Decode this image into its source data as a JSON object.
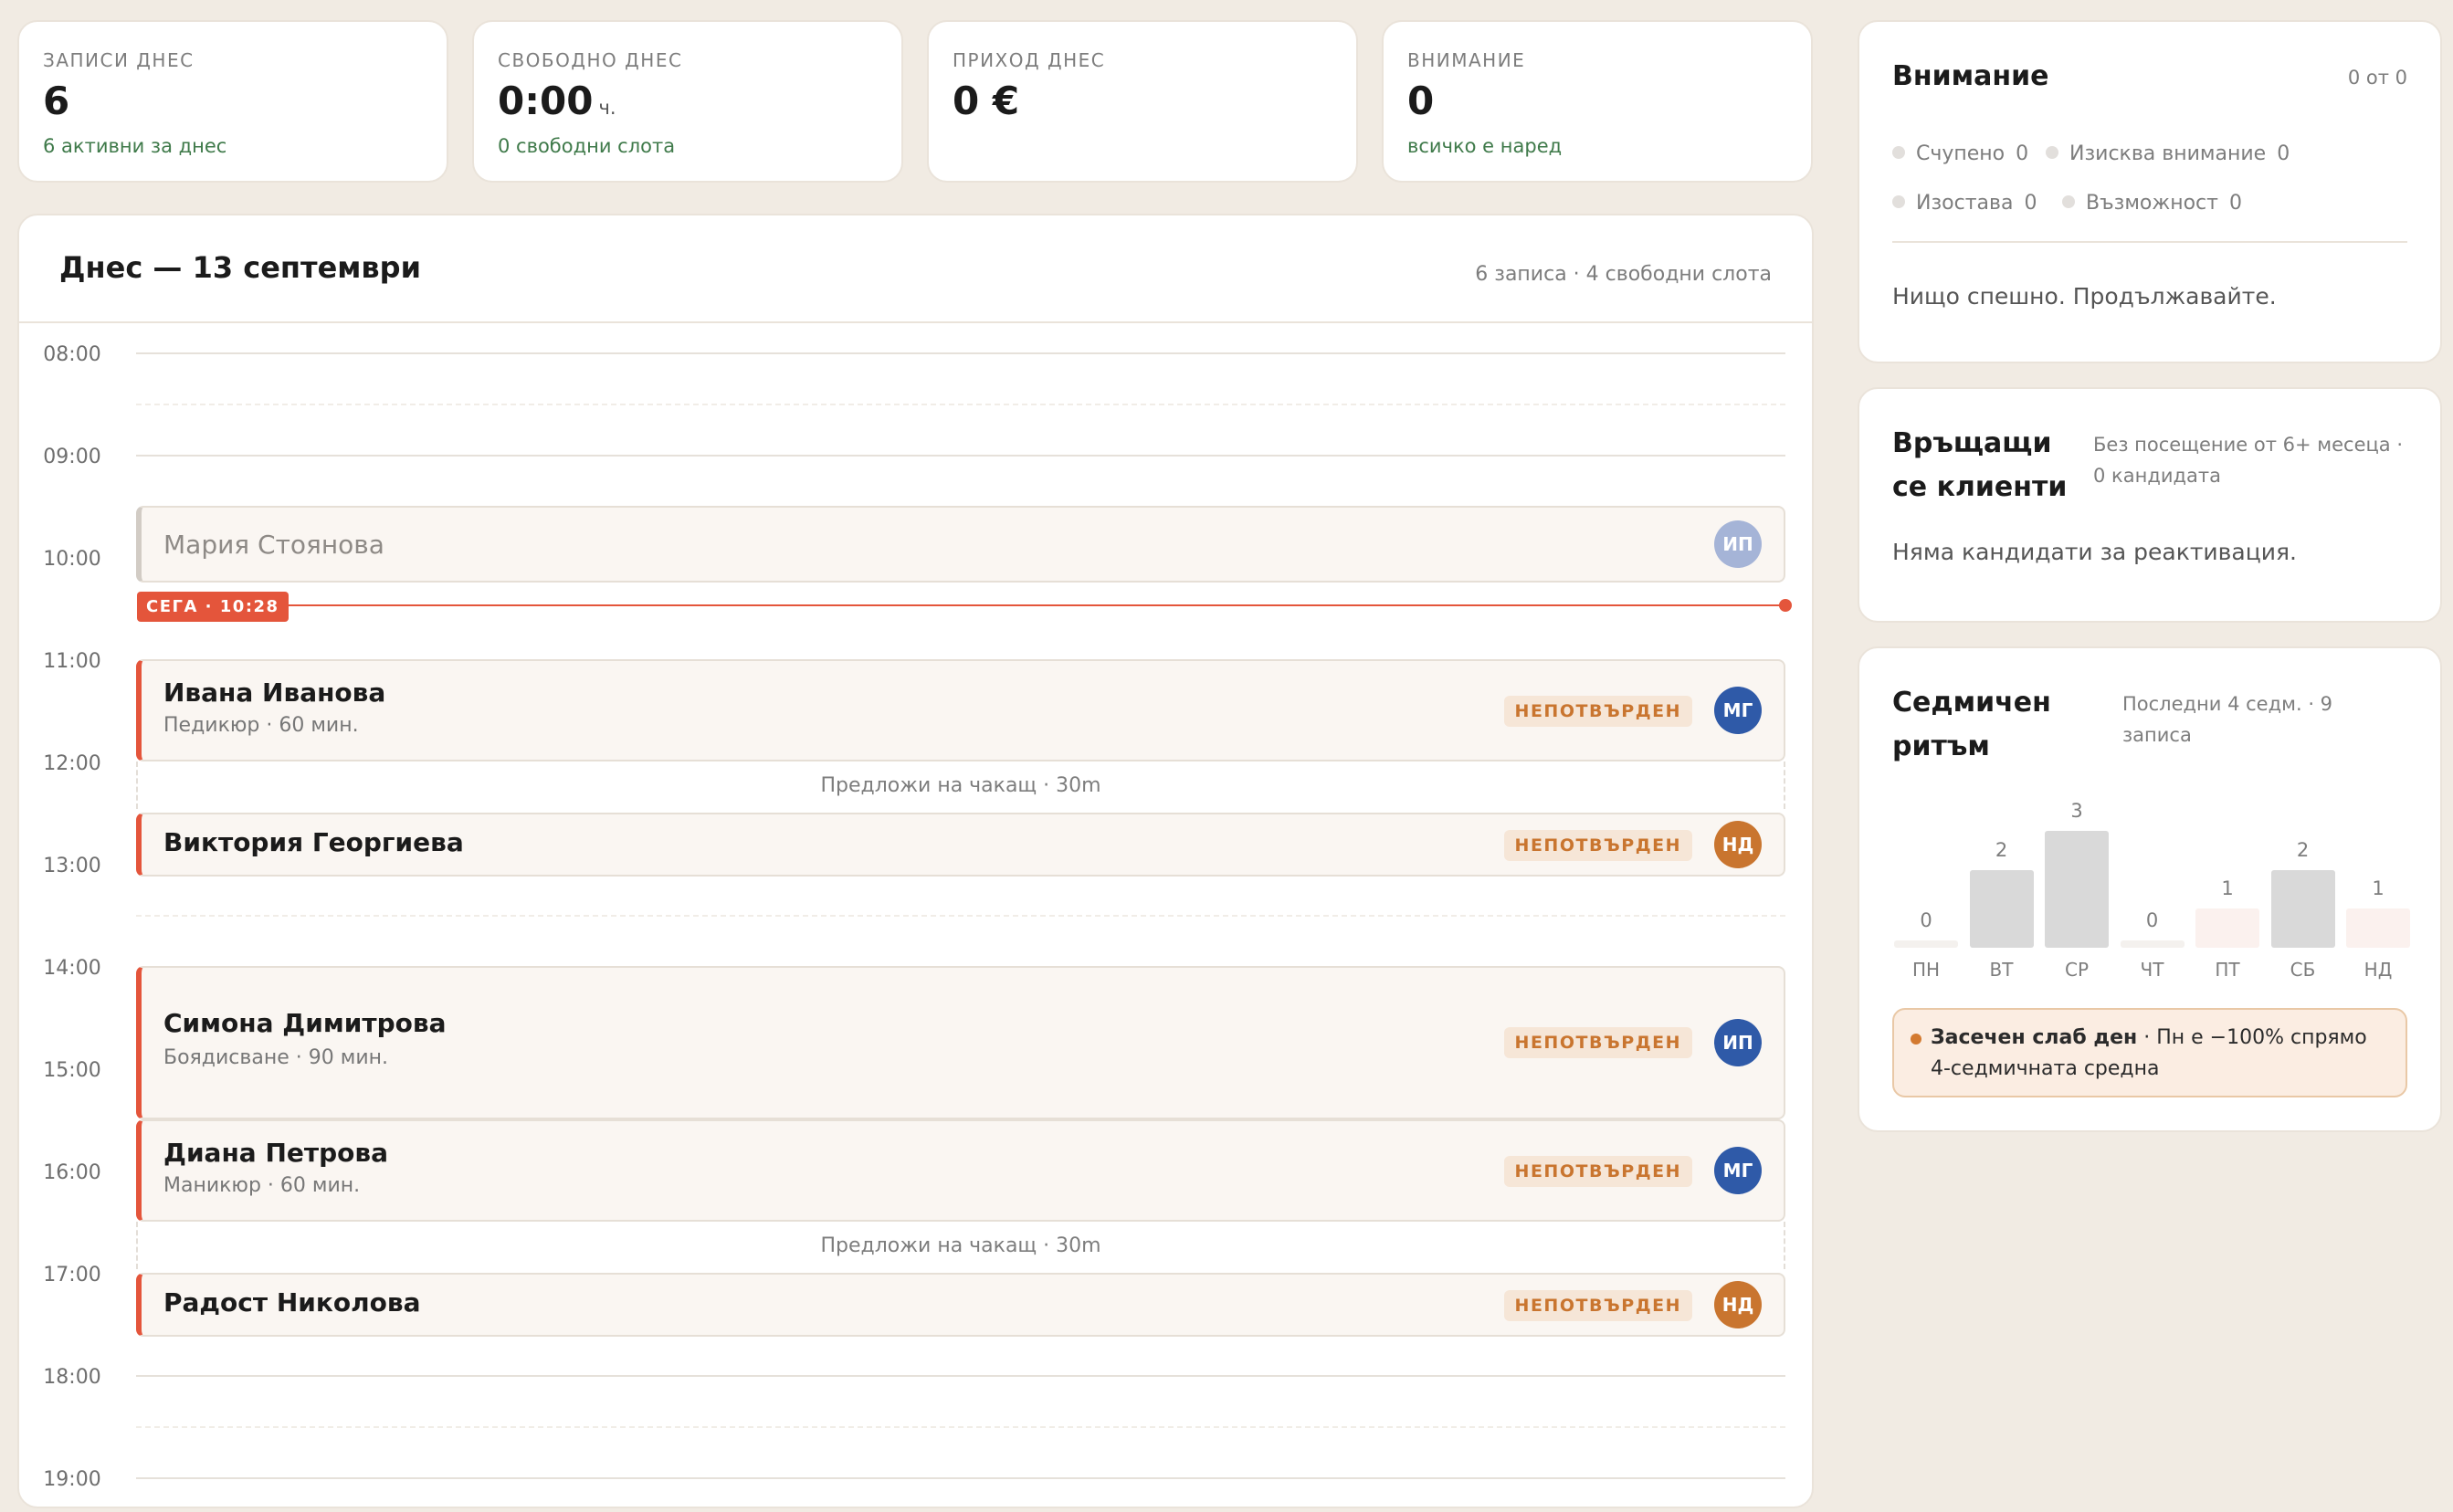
{
  "stats": [
    {
      "label": "ЗАПИСИ ДНЕС",
      "value": "6",
      "unit": "",
      "sub": "6 активни за днес"
    },
    {
      "label": "СВОБОДНО ДНЕС",
      "value": "0:00",
      "unit": "ч.",
      "sub": "0 свободни слота"
    },
    {
      "label": "ПРИХОД ДНЕС",
      "value": "0 €",
      "unit": "",
      "sub": ""
    },
    {
      "label": "ВНИМАНИЕ",
      "value": "0",
      "unit": "",
      "sub": "всичко е наред"
    }
  ],
  "schedule": {
    "title": "Днес — 13 септември",
    "meta": "6 записа · 4 свободни слота",
    "hours": [
      "08:00",
      "09:00",
      "10:00",
      "11:00",
      "12:00",
      "13:00",
      "14:00",
      "15:00",
      "16:00",
      "17:00",
      "18:00",
      "19:00"
    ],
    "now_label": "СЕГА · 10:28",
    "suggest_label": "Предложи на чакащ · 30m",
    "appointments": [
      {
        "name": "Мария Стоянова",
        "service": "",
        "status": "",
        "avatar": "ИП",
        "avatar_color": "#A5B4D7"
      },
      {
        "name": "Ивана Иванова",
        "service": "Педикюр · 60 мин.",
        "status": "НЕПОТВЪРДЕН",
        "avatar": "МГ",
        "avatar_color": "#2F5AA8"
      },
      {
        "name": "Виктория Георгиева",
        "service": "",
        "status": "НЕПОТВЪРДЕН",
        "avatar": "НД",
        "avatar_color": "#C9752F"
      },
      {
        "name": "Симона Димитрова",
        "service": "Боядисване · 90 мин.",
        "status": "НЕПОТВЪРДЕН",
        "avatar": "ИП",
        "avatar_color": "#2F5AA8"
      },
      {
        "name": "Диана Петрова",
        "service": "Маникюр · 60 мин.",
        "status": "НЕПОТВЪРДЕН",
        "avatar": "МГ",
        "avatar_color": "#2F5AA8"
      },
      {
        "name": "Радост Николова",
        "service": "",
        "status": "НЕПОТВЪРДЕН",
        "avatar": "НД",
        "avatar_color": "#C9752F"
      }
    ]
  },
  "attention": {
    "title": "Внимание",
    "count": "0 от 0",
    "items": [
      {
        "label": "Счупено",
        "count": "0"
      },
      {
        "label": "Изисква внимание",
        "count": "0"
      },
      {
        "label": "Изостава",
        "count": "0"
      },
      {
        "label": "Възможност",
        "count": "0"
      }
    ],
    "empty_text": "Нищо спешно. Продължавайте."
  },
  "returning": {
    "title": "Връщащи се клиенти",
    "meta": "Без посещение от 6+ месеца · 0 кандидата",
    "empty_text": "Няма кандидати за реактивация."
  },
  "weekly": {
    "title": "Седмичен ритъм",
    "meta": "Последни 4 седм. · 9 записа",
    "alert_bold": "Засечен слаб ден",
    "alert_text": " · Пн е −100% спрямо 4-седмичната средна"
  },
  "chart_data": {
    "type": "bar",
    "categories": [
      "ПН",
      "ВТ",
      "СР",
      "ЧТ",
      "ПТ",
      "СБ",
      "НД"
    ],
    "values": [
      0,
      2,
      3,
      0,
      1,
      2,
      1
    ],
    "ylim": [
      0,
      3
    ],
    "colors": {
      "high": "#D9D9D9",
      "low": "#FBF1EE",
      "zero": "#F4F1EE"
    }
  },
  "colors": {
    "accent": "#E4553B",
    "positive": "#3F7A4A",
    "warning": "#C9752F",
    "background": "#F1EBE3"
  }
}
